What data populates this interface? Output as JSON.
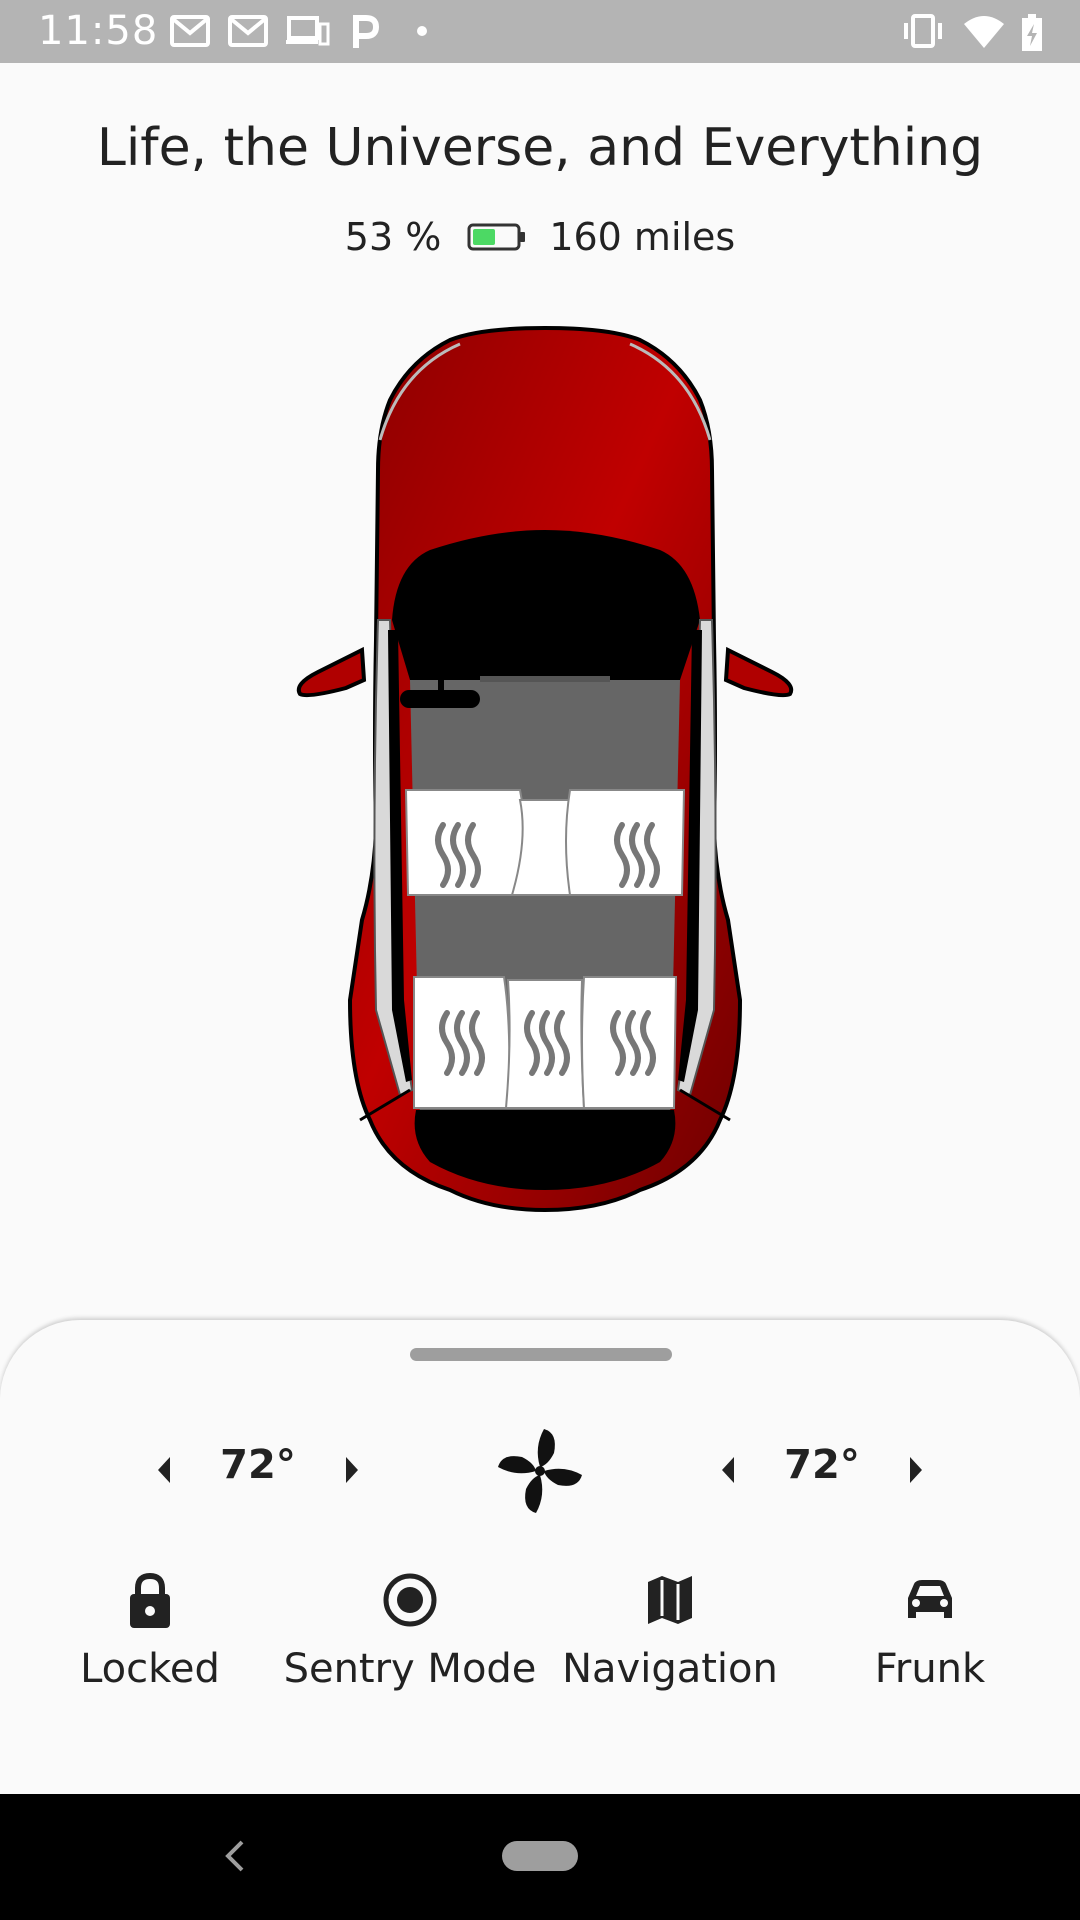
{
  "status_bar": {
    "time": "11:58",
    "icons": [
      "gmail-icon",
      "gmail-icon",
      "devices-icon",
      "parking-icon",
      "dot-icon",
      "vibrate-icon",
      "wifi-icon",
      "battery-charging-icon"
    ]
  },
  "header": {
    "title": "Life, the Universe, and Everything",
    "battery_percent": "53 %",
    "battery_level": 0.53,
    "battery_color": "#4cd964",
    "range": "160 miles"
  },
  "vehicle": {
    "color": "#c40000",
    "doors_open": [
      "driver-front",
      "passenger-front"
    ],
    "heated_seats": 5
  },
  "climate": {
    "driver_temp": "72°",
    "passenger_temp": "72°",
    "fan_icon": "fan-icon",
    "decrease_icon": "arrow-left-icon",
    "increase_icon": "arrow-right-icon"
  },
  "actions": [
    {
      "label": "Locked",
      "icon": "lock-icon"
    },
    {
      "label": "Sentry Mode",
      "icon": "record-icon"
    },
    {
      "label": "Navigation",
      "icon": "map-icon"
    },
    {
      "label": "Frunk",
      "icon": "car-icon"
    }
  ],
  "nav_bar": {
    "back_icon": "back-icon",
    "home_icon": "home-pill-icon"
  }
}
